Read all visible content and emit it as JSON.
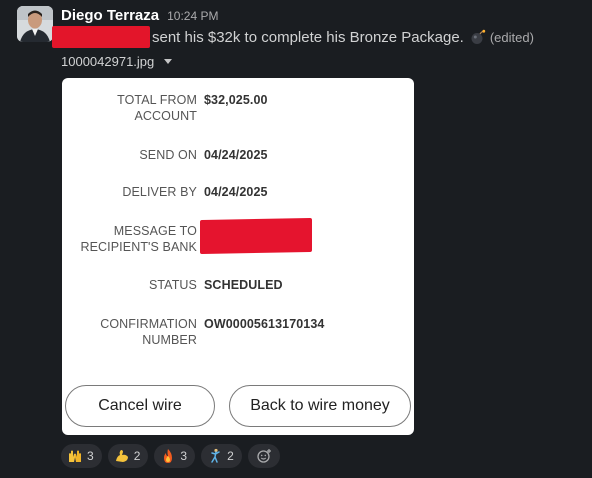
{
  "message": {
    "author": "Diego Terraza",
    "time": "10:24 PM",
    "text": "sent his $32k to complete his Bronze Package.",
    "edited": "(edited)",
    "attachment_name": "1000042971.jpg"
  },
  "wire": {
    "total_label": "TOTAL FROM",
    "total_label2": "ACCOUNT",
    "total_value": "$32,025.00",
    "send_label": "SEND ON",
    "send_value": "04/24/2025",
    "deliver_label": "DELIVER BY",
    "deliver_value": "04/24/2025",
    "message_label": "MESSAGE TO",
    "message_label2": "RECIPIENT'S BANK",
    "status_label": "STATUS",
    "status_value": "SCHEDULED",
    "confirmation_label": "CONFIRMATION",
    "confirmation_label2": "NUMBER",
    "confirmation_value": "OW00005613170134",
    "cancel_button": "Cancel wire",
    "back_button": "Back to wire money"
  },
  "reactions": [
    {
      "icon": "raised-hands-icon",
      "count": "3"
    },
    {
      "icon": "flexed-biceps-icon",
      "count": "2"
    },
    {
      "icon": "fire-icon",
      "count": "3"
    },
    {
      "icon": "dancing-icon",
      "count": "2"
    }
  ],
  "colors": {
    "background": "#1a1d21",
    "redaction": "#e3152a",
    "card": "#ffffff",
    "reaction_pill": "#2c2e33"
  }
}
